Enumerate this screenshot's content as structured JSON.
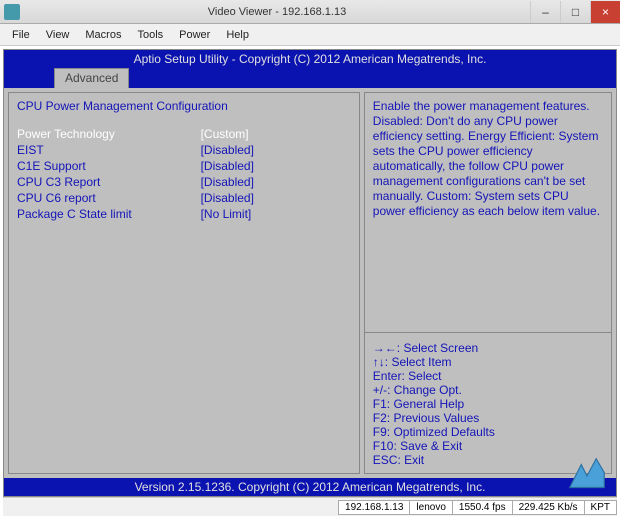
{
  "window": {
    "title": "Video Viewer - 192.168.1.13",
    "minimize": "–",
    "maximize": "□",
    "close": "×"
  },
  "menu": {
    "items": [
      "File",
      "View",
      "Macros",
      "Tools",
      "Power",
      "Help"
    ]
  },
  "bios": {
    "header": "Aptio Setup Utility - Copyright (C) 2012 American Megatrends, Inc.",
    "tab": "Advanced",
    "section_title": "CPU Power Management Configuration",
    "options": [
      {
        "label": "Power Technology",
        "value": "[Custom]",
        "selected": true
      },
      {
        "label": "EIST",
        "value": "[Disabled]",
        "selected": false
      },
      {
        "label": "C1E Support",
        "value": "[Disabled]",
        "selected": false
      },
      {
        "label": "CPU C3 Report",
        "value": "[Disabled]",
        "selected": false
      },
      {
        "label": "CPU C6 report",
        "value": "[Disabled]",
        "selected": false
      },
      {
        "label": "Package C State limit",
        "value": "[No Limit]",
        "selected": false
      }
    ],
    "help": "Enable the power management features. Disabled: Don't do any CPU power efficiency setting. Energy Efficient: System sets the CPU power efficiency automatically, the follow CPU power management configurations can't be set manually. Custom: System sets CPU power efficiency as each below item value.",
    "keys": [
      "→←: Select Screen",
      "↑↓: Select Item",
      "Enter: Select",
      "+/-: Change Opt.",
      "F1: General Help",
      "F2: Previous Values",
      "F9: Optimized Defaults",
      "F10: Save & Exit",
      "ESC: Exit"
    ],
    "footer": "Version 2.15.1236. Copyright (C) 2012 American Megatrends, Inc."
  },
  "statusbar": {
    "ip": "192.168.1.13",
    "host": "lenovo",
    "fps": "1550.4 fps",
    "kbps": "229.425 Kb/s",
    "kpt": "KPT"
  }
}
